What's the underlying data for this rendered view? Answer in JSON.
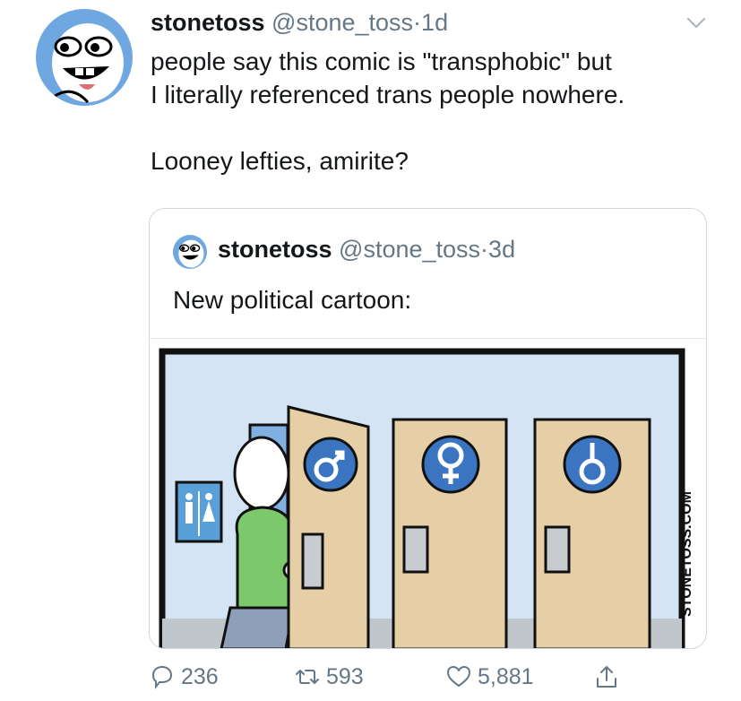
{
  "tweet": {
    "author_name": "stonetoss",
    "author_handle": "@stone_toss",
    "separator": "·",
    "time": "1d",
    "text_line1": "people say this comic is \"transphobic\" but",
    "text_line2": "I literally referenced trans people nowhere.",
    "text_line3": "Looney lefties, amirite?"
  },
  "quoted": {
    "author_name": "stonetoss",
    "author_handle": "@stone_toss",
    "separator": "·",
    "time": "3d",
    "text": "New political cartoon:",
    "image_watermark": "STONETOSS.COM"
  },
  "actions": {
    "reply_count": "236",
    "retweet_count": "593",
    "like_count": "5,881"
  },
  "icons": [
    "avatar",
    "chevron-down-icon",
    "reply-icon",
    "retweet-icon",
    "like-icon",
    "share-icon"
  ],
  "colors": {
    "text": "#14171a",
    "secondary": "#657786",
    "avatar_bg": "#6fa8e0",
    "border": "#cfd9de"
  }
}
